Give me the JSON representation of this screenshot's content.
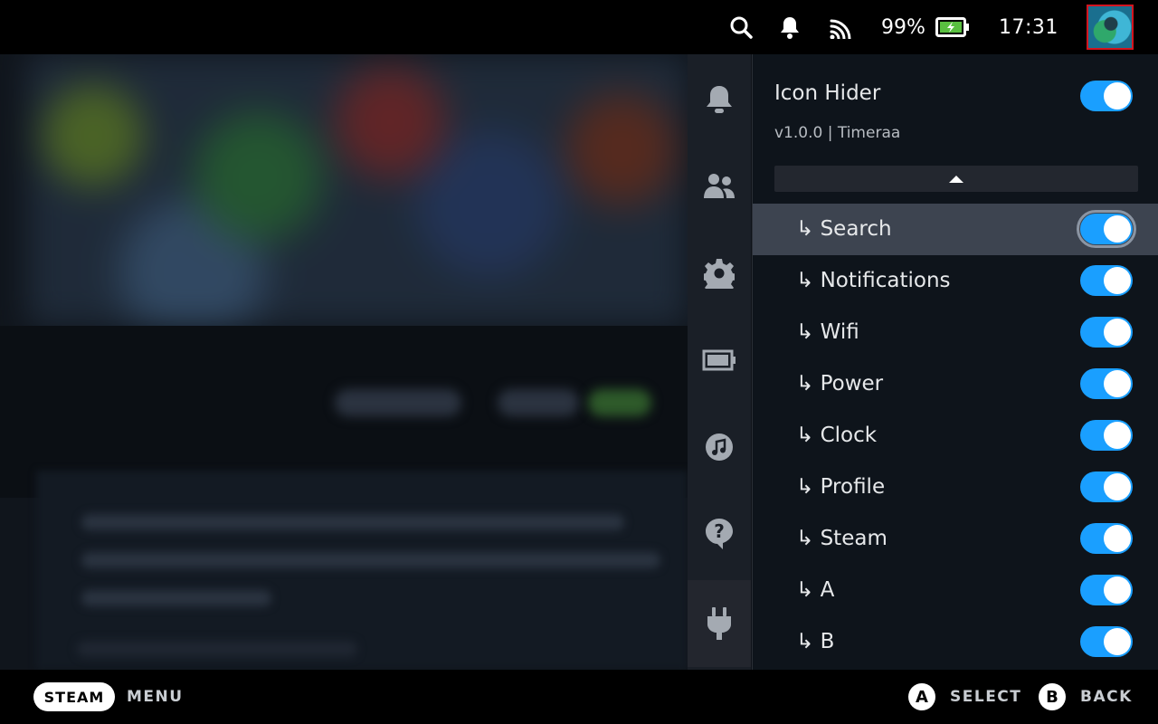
{
  "topbar": {
    "battery_percent": "99%",
    "clock": "17:31",
    "icons": [
      "search-icon",
      "bell-icon",
      "wifi-icon",
      "battery-charging-icon"
    ]
  },
  "rail": {
    "items": [
      "bell-icon",
      "friends-icon",
      "gear-icon",
      "battery-icon",
      "music-icon",
      "help-icon",
      "plug-icon"
    ],
    "active": "plug-icon"
  },
  "plugin": {
    "title": "Icon Hider",
    "meta": "v1.0.0 | Timeraa",
    "enabled": true,
    "items": [
      {
        "label": "↳ Search",
        "on": true
      },
      {
        "label": "↳ Notifications",
        "on": true
      },
      {
        "label": "↳ Wifi",
        "on": true
      },
      {
        "label": "↳ Power",
        "on": true
      },
      {
        "label": "↳ Clock",
        "on": true
      },
      {
        "label": "↳ Profile",
        "on": true
      },
      {
        "label": "↳ Steam",
        "on": true
      },
      {
        "label": "↳ A",
        "on": true
      },
      {
        "label": "↳ B",
        "on": true
      }
    ]
  },
  "bottombar": {
    "steam_label": "STEAM",
    "menu_label": "MENU",
    "a_button": "A",
    "select_label": "SELECT",
    "b_button": "B",
    "back_label": "BACK"
  },
  "colors": {
    "accent": "#1a9fff",
    "focus_row": "#3d4450",
    "panel_bg": "#0e141b",
    "rail_bg": "#1a1f27"
  }
}
